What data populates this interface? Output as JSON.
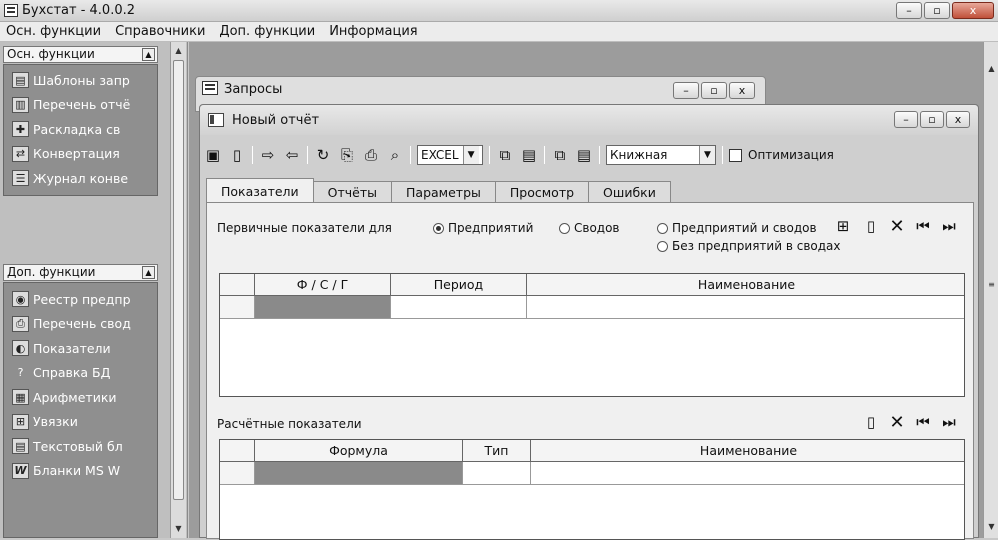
{
  "window": {
    "title": "Бухстат - 4.0.0.2",
    "buttons": [
      "–",
      "▫",
      "x"
    ]
  },
  "menu": [
    "Осн. функции",
    "Справочники",
    "Доп. функции",
    "Информация"
  ],
  "sidebar": {
    "group1": {
      "title": "Осн. функции",
      "items": [
        {
          "label": "Шаблоны запр",
          "icon": "template-icon",
          "glyph": "▤"
        },
        {
          "label": "Перечень отчё",
          "icon": "report-list-icon",
          "glyph": "▥"
        },
        {
          "label": "Раскладка св",
          "icon": "layout-icon",
          "glyph": "✚"
        },
        {
          "label": "Конвертация",
          "icon": "convert-icon",
          "glyph": "⇄"
        },
        {
          "label": "Журнал конве",
          "icon": "journal-icon",
          "glyph": "☰"
        }
      ]
    },
    "group2": {
      "title": "Доп. функции",
      "items": [
        {
          "label": "Реестр предпр",
          "icon": "registry-icon",
          "glyph": "◉"
        },
        {
          "label": "Перечень свод",
          "icon": "summary-list-icon",
          "glyph": "⎙"
        },
        {
          "label": "Показатели",
          "icon": "indicators-icon",
          "glyph": "◐"
        },
        {
          "label": "Справка БД",
          "icon": "help-icon",
          "glyph": "?"
        },
        {
          "label": "Арифметики",
          "icon": "arithmetic-icon",
          "glyph": "▦"
        },
        {
          "label": "Увязки",
          "icon": "links-icon",
          "glyph": "⊞"
        },
        {
          "label": "Текстовый бл",
          "icon": "text-block-icon",
          "glyph": "▤"
        },
        {
          "label": "Бланки MS W",
          "icon": "word-icon",
          "glyph": "W"
        }
      ]
    }
  },
  "queries_window": {
    "title": "Запросы"
  },
  "report_window": {
    "title": "Новый отчёт",
    "toolbar": {
      "format_value": "EXCEL",
      "orientation_value": "Книжная",
      "optimization_label": "Оптимизация"
    },
    "tabs": [
      "Показатели",
      "Отчёты",
      "Параметры",
      "Просмотр",
      "Ошибки"
    ],
    "primary": {
      "label": "Первичные показатели для",
      "radios": [
        "Предприятий",
        "Сводов",
        "Предприятий и сводов",
        "Без предприятий в сводах"
      ],
      "columns": [
        "Ф / С / Г",
        "Период",
        "Наименование"
      ]
    },
    "calculated": {
      "label": "Расчётные показатели",
      "columns": [
        "Формула",
        "Тип",
        "Наименование"
      ]
    }
  },
  "colors": {
    "selected_cell": "#8a8a8a",
    "panel": "#8f8f8f"
  }
}
